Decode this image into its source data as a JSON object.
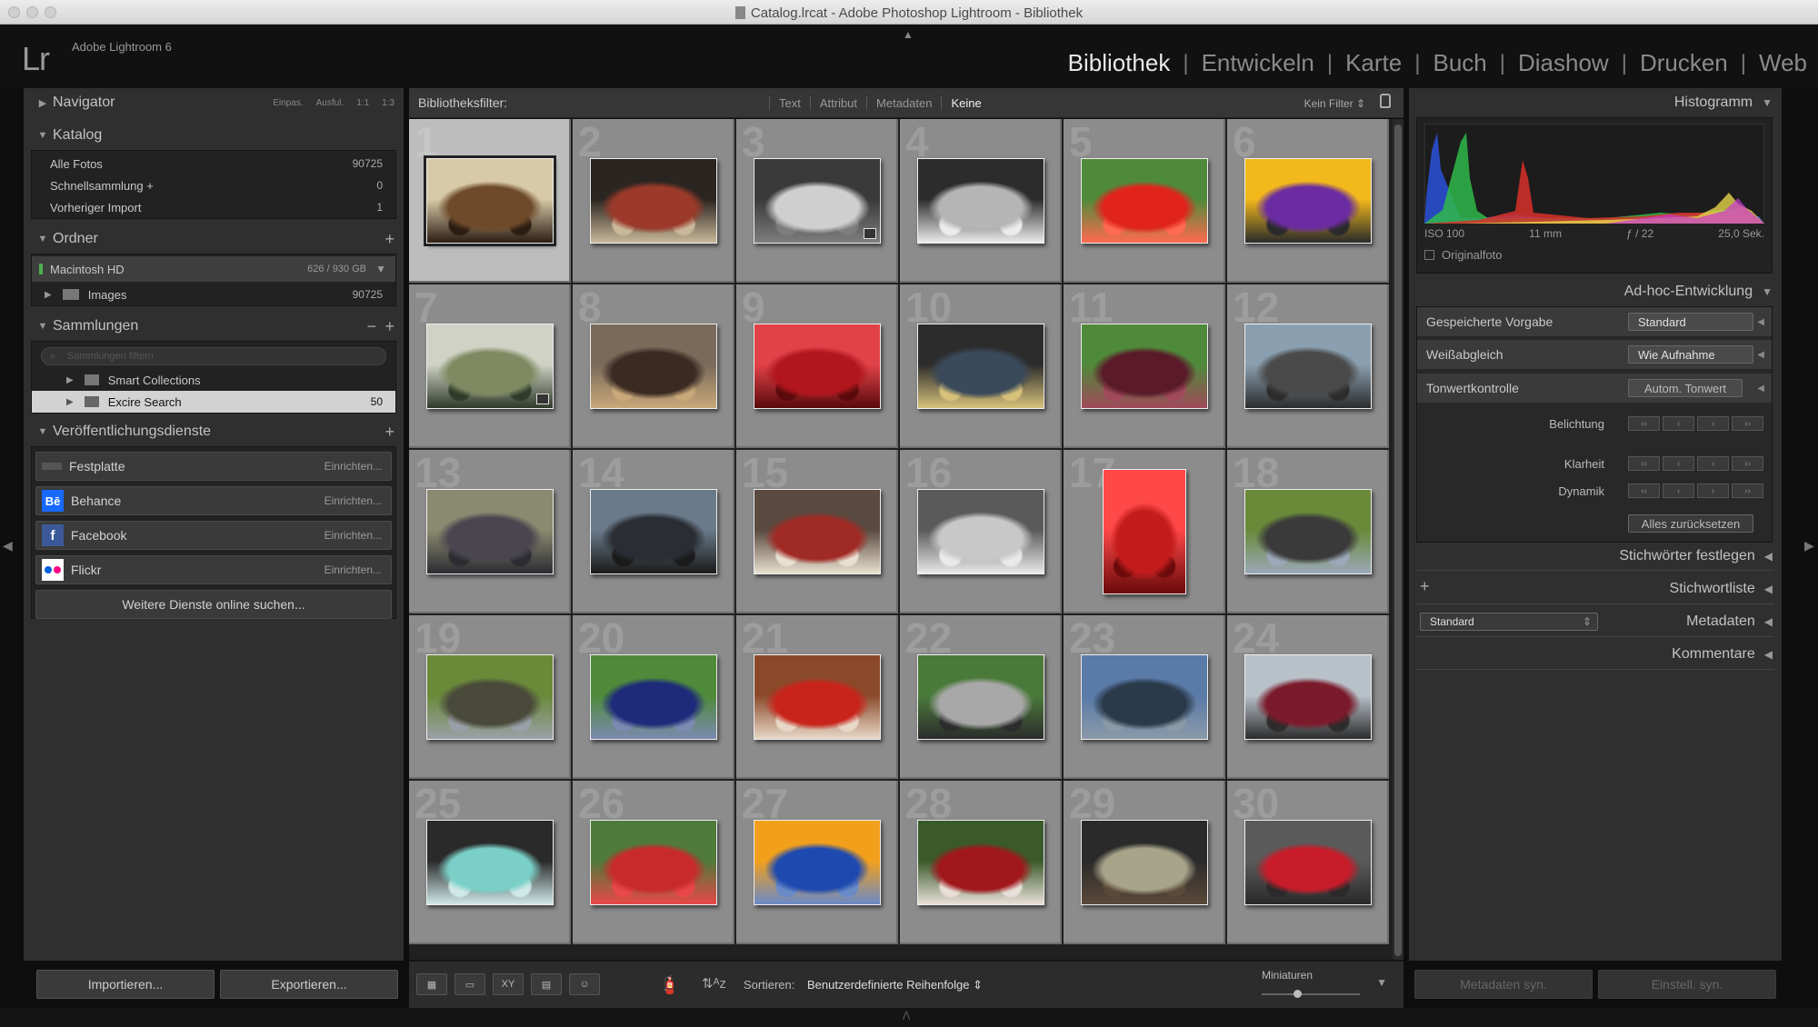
{
  "window": {
    "title": "Catalog.lrcat - Adobe Photoshop Lightroom - Bibliothek"
  },
  "app": {
    "logo": "Lr",
    "name": "Adobe Lightroom 6"
  },
  "modules": [
    "Bibliothek",
    "Entwickeln",
    "Karte",
    "Buch",
    "Diashow",
    "Drucken",
    "Web"
  ],
  "left": {
    "navigator": {
      "label": "Navigator",
      "zoom": [
        "Einpas.",
        "Ausful.",
        "1:1",
        "1:3"
      ]
    },
    "katalog": {
      "label": "Katalog",
      "items": [
        {
          "label": "Alle Fotos",
          "count": "90725"
        },
        {
          "label": "Schnellsammlung +",
          "count": "0"
        },
        {
          "label": "Vorheriger Import",
          "count": "1"
        }
      ]
    },
    "ordner": {
      "label": "Ordner",
      "volume": "Macintosh HD",
      "volume_size": "626 / 930 GB",
      "folder": "Images",
      "folder_count": "90725"
    },
    "sammlungen": {
      "label": "Sammlungen",
      "filter_placeholder": "Sammlungen filtern",
      "items": [
        {
          "label": "Smart Collections",
          "count": ""
        },
        {
          "label": "Excire Search",
          "count": "50"
        }
      ]
    },
    "publish": {
      "label": "Veröffentlichungsdienste",
      "items": [
        {
          "label": "Festplatte",
          "action": "Einrichten..."
        },
        {
          "label": "Behance",
          "action": "Einrichten..."
        },
        {
          "label": "Facebook",
          "action": "Einrichten..."
        },
        {
          "label": "Flickr",
          "action": "Einrichten..."
        }
      ],
      "more": "Weitere Dienste online suchen..."
    },
    "import_label": "Importieren...",
    "export_label": "Exportieren..."
  },
  "filter": {
    "label": "Bibliotheksfilter:",
    "tabs": [
      "Text",
      "Attribut",
      "Metadaten",
      "Keine"
    ],
    "active": "Keine",
    "preset": "Kein Filter"
  },
  "grid": {
    "selected_index": 0,
    "cells": [
      {
        "n": "1",
        "colors": [
          "#6e4a2a",
          "#d8c9a8",
          "#2b1d12"
        ],
        "o": "l",
        "badge": false
      },
      {
        "n": "2",
        "colors": [
          "#9b3a2a",
          "#2a2520",
          "#c9b89a"
        ],
        "o": "l",
        "badge": false
      },
      {
        "n": "3",
        "colors": [
          "#cfcfcf",
          "#3a3a3a",
          "#7d7d7d"
        ],
        "o": "l",
        "badge": true
      },
      {
        "n": "4",
        "colors": [
          "#b5b5b5",
          "#2c2c2c",
          "#ececec"
        ],
        "o": "l",
        "badge": false
      },
      {
        "n": "5",
        "colors": [
          "#e0241c",
          "#4f8a3a",
          "#ff6a50"
        ],
        "o": "l",
        "badge": false
      },
      {
        "n": "6",
        "colors": [
          "#6a2ca0",
          "#f2b81c",
          "#2a2a2a"
        ],
        "o": "l",
        "badge": false
      },
      {
        "n": "7",
        "colors": [
          "#7f8a62",
          "#cfd2c4",
          "#2f3a2a"
        ],
        "o": "l",
        "badge": true
      },
      {
        "n": "8",
        "colors": [
          "#3a2a22",
          "#7a6a5a",
          "#c9a87a"
        ],
        "o": "l",
        "badge": false
      },
      {
        "n": "9",
        "colors": [
          "#b0161c",
          "#e04248",
          "#5a0a0c"
        ],
        "o": "l",
        "badge": false
      },
      {
        "n": "10",
        "colors": [
          "#3a4a5a",
          "#2c2c2c",
          "#d8c27a"
        ],
        "o": "l",
        "badge": false
      },
      {
        "n": "11",
        "colors": [
          "#5a1a2a",
          "#4f8a3a",
          "#a04a5a"
        ],
        "o": "l",
        "badge": false
      },
      {
        "n": "12",
        "colors": [
          "#4a4a4a",
          "#8aa0b0",
          "#2c2c2c"
        ],
        "o": "l",
        "badge": false
      },
      {
        "n": "13",
        "colors": [
          "#4a4650",
          "#8a8a70",
          "#2c2c32"
        ],
        "o": "l",
        "badge": false
      },
      {
        "n": "14",
        "colors": [
          "#2a2e34",
          "#6a7a8a",
          "#1a1a1a"
        ],
        "o": "l",
        "badge": false
      },
      {
        "n": "15",
        "colors": [
          "#a02a24",
          "#5a4a40",
          "#e8e0d0"
        ],
        "o": "l",
        "badge": false
      },
      {
        "n": "16",
        "colors": [
          "#c8c8c8",
          "#5a5a5a",
          "#eaeaea"
        ],
        "o": "l",
        "badge": false
      },
      {
        "n": "17",
        "colors": [
          "#c41c1c",
          "#ff4848",
          "#6a0a0a"
        ],
        "o": "p",
        "badge": false
      },
      {
        "n": "18",
        "colors": [
          "#3a3a3a",
          "#6a8a3a",
          "#9aa8b8"
        ],
        "o": "l",
        "badge": false
      },
      {
        "n": "19",
        "colors": [
          "#4a4a3a",
          "#6a8a3a",
          "#9aa0a8"
        ],
        "o": "l",
        "badge": false
      },
      {
        "n": "20",
        "colors": [
          "#1e2a7a",
          "#4f8a3a",
          "#7a8ab0"
        ],
        "o": "l",
        "badge": false
      },
      {
        "n": "21",
        "colors": [
          "#c8241c",
          "#8a4a2a",
          "#e8d8c8"
        ],
        "o": "l",
        "badge": false
      },
      {
        "n": "22",
        "colors": [
          "#a8a8a8",
          "#4a7a3a",
          "#2c2c2c"
        ],
        "o": "l",
        "badge": false
      },
      {
        "n": "23",
        "colors": [
          "#2a3a4a",
          "#5a7aa8",
          "#8a9aa8"
        ],
        "o": "l",
        "badge": false
      },
      {
        "n": "24",
        "colors": [
          "#7a1a2a",
          "#b8c0c8",
          "#2c2c2c"
        ],
        "o": "l",
        "badge": false
      },
      {
        "n": "25",
        "colors": [
          "#7ad0c8",
          "#2a2a2a",
          "#d0e8e8"
        ],
        "o": "l",
        "badge": false
      },
      {
        "n": "26",
        "colors": [
          "#c82a2a",
          "#4f7a3a",
          "#e84848"
        ],
        "o": "l",
        "badge": false
      },
      {
        "n": "27",
        "colors": [
          "#1e4ab0",
          "#f2a01c",
          "#6a8ac8"
        ],
        "o": "l",
        "badge": false
      },
      {
        "n": "28",
        "colors": [
          "#a0181c",
          "#3a5a2a",
          "#e8e0d8"
        ],
        "o": "l",
        "badge": false
      },
      {
        "n": "29",
        "colors": [
          "#a8a48a",
          "#2a2a2a",
          "#5a4a3a"
        ],
        "o": "l",
        "badge": false
      },
      {
        "n": "30",
        "colors": [
          "#c81c2a",
          "#5a5a5a",
          "#2a2a2a"
        ],
        "o": "l",
        "badge": false
      }
    ]
  },
  "toolbar": {
    "sort_label": "Sortieren:",
    "sort_value": "Benutzerdefinierte Reihenfolge",
    "thumb_label": "Miniaturen",
    "view_icons": [
      "grid-view-icon",
      "loupe-view-icon",
      "compare-view-icon",
      "survey-view-icon",
      "people-view-icon"
    ]
  },
  "right": {
    "histogram": {
      "label": "Histogramm",
      "iso": "ISO 100",
      "focal": "11 mm",
      "aperture": "ƒ / 22",
      "shutter": "25,0 Sek.",
      "original": "Originalfoto"
    },
    "quick_develop": {
      "label": "Ad-hoc-Entwicklung",
      "preset_label": "Gespeicherte Vorgabe",
      "preset_value": "Standard",
      "wb_label": "Weißabgleich",
      "wb_value": "Wie Aufnahme",
      "tone_label": "Tonwertkontrolle",
      "tone_value": "Autom. Tonwert",
      "exposure": "Belichtung",
      "clarity": "Klarheit",
      "vibrance": "Dynamik",
      "reset": "Alles zurücksetzen"
    },
    "keywording": "Stichwörter festlegen",
    "keyword_list": "Stichwortliste",
    "metadata_label": "Metadaten",
    "metadata_preset": "Standard",
    "comments": "Kommentare",
    "sync_meta": "Metadaten syn.",
    "sync_settings": "Einstell. syn."
  },
  "colors": {
    "panel": "#2f2f2f",
    "grid_cell": "#8c8c8c",
    "grid_selected": "#bdbdbd",
    "behance": "#1769ff",
    "facebook": "#3b5998",
    "flickr_pink": "#ff0084",
    "flickr_blue": "#0063dc"
  }
}
